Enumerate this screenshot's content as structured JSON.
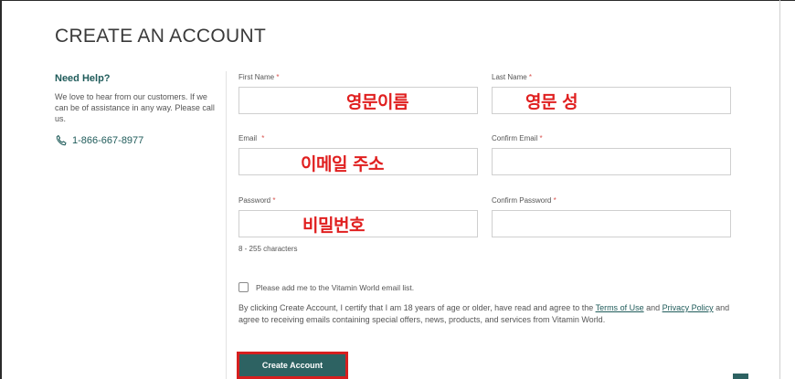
{
  "page": {
    "title": "CREATE AN ACCOUNT"
  },
  "help": {
    "title": "Need Help?",
    "text": "We love to hear from our customers. If we can be of assistance in any way. Please call us.",
    "phone": "1-866-667-8977",
    "phone_icon": "phone-icon"
  },
  "form": {
    "first_name": {
      "label": "First Name",
      "required": "*",
      "value": "",
      "annotation": "영문이름"
    },
    "last_name": {
      "label": "Last Name",
      "required": "*",
      "value": "",
      "annotation": "영문 성"
    },
    "email": {
      "label": "Email",
      "required": "*",
      "value": "",
      "annotation": "이메일 주소"
    },
    "confirm_email": {
      "label": "Confirm Email",
      "required": "*",
      "value": ""
    },
    "password": {
      "label": "Password",
      "required": "*",
      "value": "",
      "annotation": "비밀번호",
      "hint": "8 - 255 characters"
    },
    "confirm_password": {
      "label": "Confirm Password",
      "required": "*",
      "value": ""
    },
    "newsletter": {
      "label": "Please add me to the Vitamin World email list.",
      "checked": false
    },
    "legal": {
      "part1": "By clicking Create Account, I certify that I am 18 years of age or older, have read and agree to the ",
      "terms_link": "Terms of Use",
      "part2": " and ",
      "privacy_link": "Privacy Policy",
      "part3": " and agree to receiving emails containing special offers, news, products, and services from Vitamin World."
    },
    "submit_label": "Create Account"
  },
  "colors": {
    "brand": "#2d6262",
    "annotation": "#e02020",
    "required": "#d9534f"
  }
}
